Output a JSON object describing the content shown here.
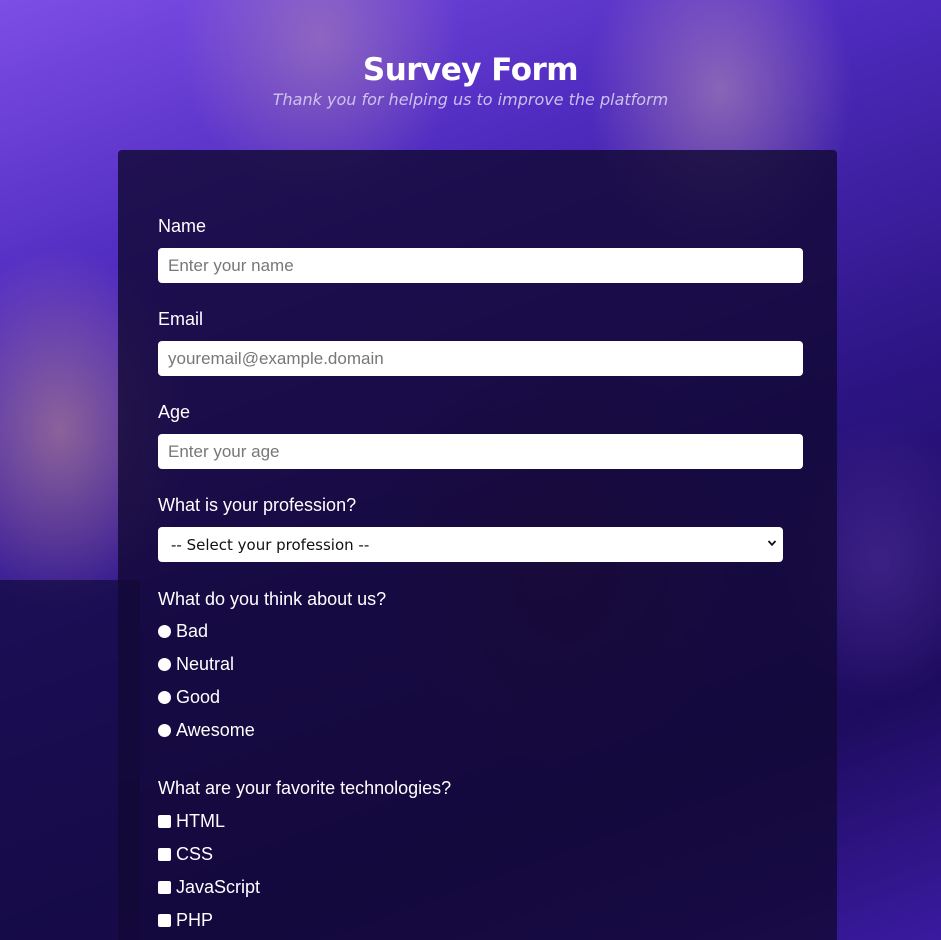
{
  "header": {
    "title": "Survey Form",
    "subtitle": "Thank you for helping us to improve the platform"
  },
  "form": {
    "name": {
      "label": "Name",
      "placeholder": "Enter your name",
      "value": ""
    },
    "email": {
      "label": "Email",
      "placeholder": "youremail@example.domain",
      "value": ""
    },
    "age": {
      "label": "Age",
      "placeholder": "Enter your age",
      "value": ""
    },
    "profession": {
      "label": "What is your profession?",
      "selected": "-- Select your profession --"
    },
    "opinion": {
      "label": "What do you think about us?",
      "options": [
        "Bad",
        "Neutral",
        "Good",
        "Awesome"
      ]
    },
    "technologies": {
      "label": "What are your favorite technologies?",
      "options": [
        "HTML",
        "CSS",
        "JavaScript",
        "PHP"
      ]
    }
  },
  "icons": {
    "select_arrow": "chevron-down-icon",
    "radio": "radio-button-icon",
    "checkbox": "checkbox-icon"
  },
  "colors": {
    "background_top": "#7d4ee6",
    "background_bottom": "#1d0c5e",
    "card": "#120836",
    "text": "#ffffff"
  }
}
